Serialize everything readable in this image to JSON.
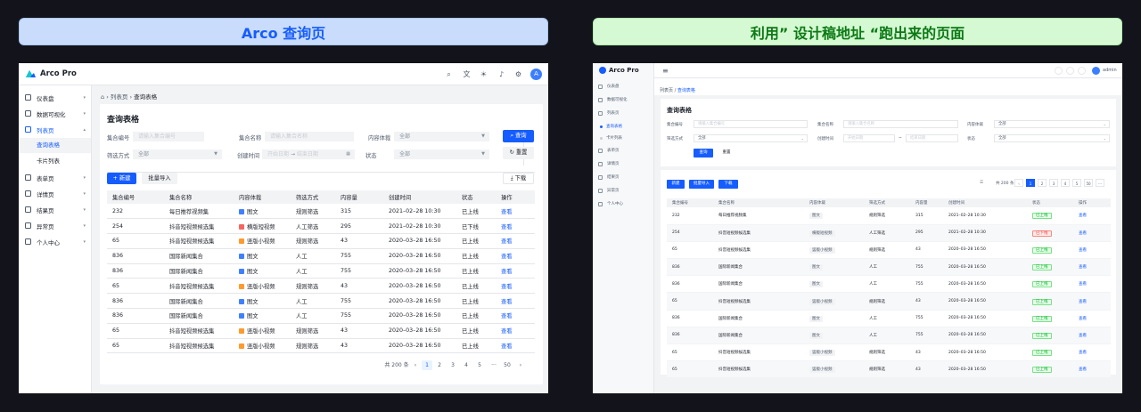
{
  "banners": {
    "left": "Arco 查询页",
    "right": "利用” 设计稿地址 “跑出来的页面"
  },
  "left": {
    "brand": "Arco Pro",
    "avatar": "A",
    "menu": [
      {
        "label": "仪表盘"
      },
      {
        "label": "数据可视化"
      },
      {
        "label": "列表页"
      },
      {
        "label": "表单页"
      },
      {
        "label": "详情页"
      },
      {
        "label": "结果页"
      },
      {
        "label": "异常页"
      },
      {
        "label": "个人中心"
      }
    ],
    "submenu": [
      "查询表格",
      "卡片列表"
    ],
    "breadcrumb": {
      "parent": "列表页",
      "current": "查询表格"
    },
    "title": "查询表格",
    "form": {
      "id_label": "集合编号",
      "id_ph": "请输入集合编号",
      "name_label": "集合名称",
      "name_ph": "请输入集合名称",
      "type_label": "内容体裁",
      "type_val": "全部",
      "filter_label": "筛选方式",
      "filter_val": "全部",
      "time_label": "创建时间",
      "start_ph": "开始日期",
      "arrow": "→",
      "end_ph": "结束日期",
      "status_label": "状态",
      "status_val": "全部",
      "search": "查询",
      "reset": "重置"
    },
    "toolbar": {
      "new": "新建",
      "import": "批量导入",
      "download": "下载"
    },
    "columns": [
      "集合编号",
      "集合名称",
      "内容体裁",
      "筛选方式",
      "内容量",
      "创建时间",
      "状态",
      "操作"
    ],
    "rows": [
      {
        "id": "232",
        "name": "每日推荐视频集",
        "type": "图文",
        "c": "#4080ff",
        "filter": "规则筛选",
        "count": "315",
        "time": "2021–02–28 10:30",
        "status": "已上线",
        "op": "查看"
      },
      {
        "id": "254",
        "name": "抖音短视频候选集",
        "type": "横版短视频",
        "c": "#f76560",
        "filter": "人工筛选",
        "count": "295",
        "time": "2021–02–28 10:30",
        "status": "已下线",
        "op": "查看"
      },
      {
        "id": "65",
        "name": "抖音短视频候选集",
        "type": "竖版小视频",
        "c": "#ff9a2e",
        "filter": "规则筛选",
        "count": "43",
        "time": "2020–03–28 16:50",
        "status": "已上线",
        "op": "查看"
      },
      {
        "id": "836",
        "name": "国际新闻集合",
        "type": "图文",
        "c": "#4080ff",
        "filter": "人工",
        "count": "755",
        "time": "2020–03–28 16:50",
        "status": "已上线",
        "op": "查看"
      },
      {
        "id": "836",
        "name": "国际新闻集合",
        "type": "图文",
        "c": "#4080ff",
        "filter": "人工",
        "count": "755",
        "time": "2020–03–28 16:50",
        "status": "已上线",
        "op": "查看"
      },
      {
        "id": "65",
        "name": "抖音短视频候选集",
        "type": "竖版小视频",
        "c": "#ff9a2e",
        "filter": "规则筛选",
        "count": "43",
        "time": "2020–03–28 16:50",
        "status": "已上线",
        "op": "查看"
      },
      {
        "id": "836",
        "name": "国际新闻集合",
        "type": "图文",
        "c": "#4080ff",
        "filter": "人工",
        "count": "755",
        "time": "2020–03–28 16:50",
        "status": "已上线",
        "op": "查看"
      },
      {
        "id": "836",
        "name": "国际新闻集合",
        "type": "图文",
        "c": "#4080ff",
        "filter": "人工",
        "count": "755",
        "time": "2020–03–28 16:50",
        "status": "已上线",
        "op": "查看"
      },
      {
        "id": "65",
        "name": "抖音短视频候选集",
        "type": "竖版小视频",
        "c": "#ff9a2e",
        "filter": "规则筛选",
        "count": "43",
        "time": "2020–03–28 16:50",
        "status": "已上线",
        "op": "查看"
      },
      {
        "id": "65",
        "name": "抖音短视频候选集",
        "type": "竖版小视频",
        "c": "#ff9a2e",
        "filter": "规则筛选",
        "count": "43",
        "time": "2020–03–28 16:50",
        "status": "已上线",
        "op": "查看"
      }
    ],
    "pagination": {
      "total": "共 200 条",
      "prev": "‹",
      "pages": [
        "1",
        "2",
        "3",
        "4",
        "5",
        "···",
        "50"
      ],
      "next": "›"
    }
  },
  "right": {
    "brand": "Arco Pro",
    "user": "admin",
    "menu": [
      "仪表盘",
      "数据可视化",
      "列表页",
      "查询表格",
      "卡片列表",
      "表单页",
      "详情页",
      "结果页",
      "异常页",
      "个人中心"
    ],
    "breadcrumb": {
      "parent": "列表页",
      "sep": "/",
      "current": "查询表格"
    },
    "title": "查询表格",
    "form": {
      "id_label": "集合编号",
      "id_ph": "请输入集合编号",
      "name_label": "集合名称",
      "name_ph": "请输入集合名称",
      "type_label": "内容体裁",
      "type_val": "全部",
      "filter_label": "筛选方式",
      "filter_val": "全部",
      "time_label": "创建时间",
      "start_ph": "开始日期",
      "sep": "~",
      "end_ph": "结束日期",
      "status_label": "状态",
      "status_val": "全部",
      "search": "查询",
      "reset": "重置"
    },
    "toolbar": {
      "new": "新建",
      "import": "批量导入",
      "download": "下载"
    },
    "pagination": {
      "total": "共 200 条",
      "prev": "‹",
      "pages": [
        "1",
        "2",
        "3",
        "4",
        "5",
        "50"
      ],
      "next": "›",
      "more": "···"
    },
    "columns": [
      "集合编号",
      "集合名称",
      "内容体裁",
      "筛选方式",
      "内容量",
      "创建时间",
      "状态",
      "操作"
    ]
  }
}
